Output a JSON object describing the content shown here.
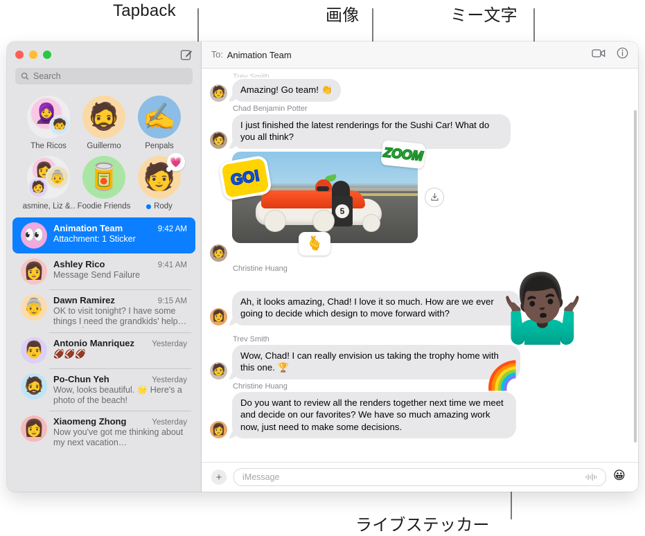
{
  "annotations": [
    {
      "id": "tapback",
      "label": "Tapback"
    },
    {
      "id": "image",
      "label": "画像"
    },
    {
      "id": "memoji",
      "label": "ミー文字"
    },
    {
      "id": "live_sticker",
      "label": "ライブステッカー"
    }
  ],
  "sidebar": {
    "search": {
      "placeholder": "Search",
      "icon": "search-icon"
    },
    "compose_icon": "compose-icon",
    "pinned": [
      {
        "name": "The Ricos",
        "emoji": "🧕",
        "bg": "#eeeef0",
        "type": "group",
        "unread": false,
        "tapback": null
      },
      {
        "name": "Guillermo",
        "emoji": "🧔",
        "bg": "#fbd9a4",
        "type": "single",
        "unread": false,
        "tapback": null
      },
      {
        "name": "Penpals",
        "emoji": "✍️",
        "bg": "#8cbde6",
        "type": "single",
        "unread": false,
        "tapback": null
      },
      {
        "name": "Jasmine, Liz &…",
        "emoji": "👩",
        "bg": "#eeeef0",
        "type": "group",
        "unread": false,
        "tapback": null
      },
      {
        "name": "Foodie Friends",
        "emoji": "🥫",
        "bg": "#a9e6a3",
        "type": "single",
        "unread": false,
        "tapback": null
      },
      {
        "name": "Rody",
        "emoji": "🧑",
        "bg": "#fbd9a4",
        "type": "single",
        "unread": true,
        "tapback": "💗"
      }
    ],
    "conversations": [
      {
        "name": "Animation Team",
        "time": "9:42 AM",
        "preview": "Attachment: 1 Sticker",
        "avatar": "👀",
        "avatar_bg": "#f3a9e0",
        "selected": true
      },
      {
        "name": "Ashley Rico",
        "time": "9:41 AM",
        "preview": "Message Send Failure",
        "avatar": "👩",
        "avatar_bg": "#f7c3c3",
        "selected": false
      },
      {
        "name": "Dawn Ramirez",
        "time": "9:15 AM",
        "preview": "OK to visit tonight? I have some things I need the grandkids' help with. 🥰",
        "avatar": "👵",
        "avatar_bg": "#fbdcae",
        "selected": false
      },
      {
        "name": "Antonio Manriquez",
        "time": "Yesterday",
        "preview": "🏈🏈🏈",
        "avatar": "👨",
        "avatar_bg": "#dcd0f7",
        "selected": false
      },
      {
        "name": "Po-Chun Yeh",
        "time": "Yesterday",
        "preview": "Wow, looks beautiful. 🌟 Here's a photo of the beach!",
        "avatar": "🧔",
        "avatar_bg": "#bfe4f5",
        "selected": false
      },
      {
        "name": "Xiaomeng Zhong",
        "time": "Yesterday",
        "preview": "Now you've got me thinking about my next vacation…",
        "avatar": "👩",
        "avatar_bg": "#f7b9b9",
        "selected": false
      }
    ]
  },
  "thread": {
    "to_label": "To:",
    "to_name": "Animation Team",
    "facetime_icon": "video-camera-icon",
    "info_icon": "info-icon",
    "messages": [
      {
        "type": "text",
        "sender": "Trev Smith",
        "sender_visible": false,
        "text": "Amazing! Go team! 👏",
        "avatar": "🧑",
        "avatar_bg": "#c9c0b4"
      },
      {
        "type": "text",
        "sender": "Chad Benjamin Potter",
        "sender_visible": true,
        "text": "I just finished the latest renderings for the Sushi Car! What do you all think?",
        "avatar": "🧑",
        "avatar_bg": "#b9a38c"
      },
      {
        "type": "photo",
        "sender": "",
        "sender_visible": false,
        "avatar": "🧑",
        "avatar_bg": "#b9a38c",
        "alt": "Sushi race car on track",
        "car_number": "5",
        "stickers": [
          {
            "name": "go-sticker",
            "text": "GO!"
          },
          {
            "name": "zoom-sticker",
            "text": "ZOOM"
          },
          {
            "name": "heart-hands-sticker",
            "text": "🫰"
          }
        ],
        "download_icon": "download-icon"
      },
      {
        "type": "text",
        "sender": "Christine Huang",
        "sender_visible": true,
        "text": "Ah, it looks amazing, Chad! I love it so much. How are we ever going to decide which design to move forward with?",
        "avatar": "👩",
        "avatar_bg": "#e8a86a"
      },
      {
        "type": "text",
        "sender": "Trev Smith",
        "sender_visible": true,
        "text": "Wow, Chad! I can really envision us taking the trophy home with this one. 🏆",
        "avatar": "🧑",
        "avatar_bg": "#c9c0b4"
      },
      {
        "type": "text",
        "sender": "Christine Huang",
        "sender_visible": true,
        "text": "Do you want to review all the renders together next time we meet and decide on our favorites? We have so much amazing work now, just need to make some decisions.",
        "avatar": "👩",
        "avatar_bg": "#e8a86a"
      }
    ],
    "composer": {
      "plus_icon": "plus-icon",
      "placeholder": "iMessage",
      "audio_icon": "audio-waveform-icon",
      "emoji_icon": "emoji-smiley-icon"
    }
  },
  "overlays": {
    "memoji_sticker": "🤷🏿‍♂️",
    "rainbow_sticker": "🌈"
  },
  "colors": {
    "selection_blue": "#0b7fff",
    "sidebar_bg": "#e4e4e6",
    "bubble_gray": "#e8e8ea",
    "unread_dot": "#007aff"
  }
}
